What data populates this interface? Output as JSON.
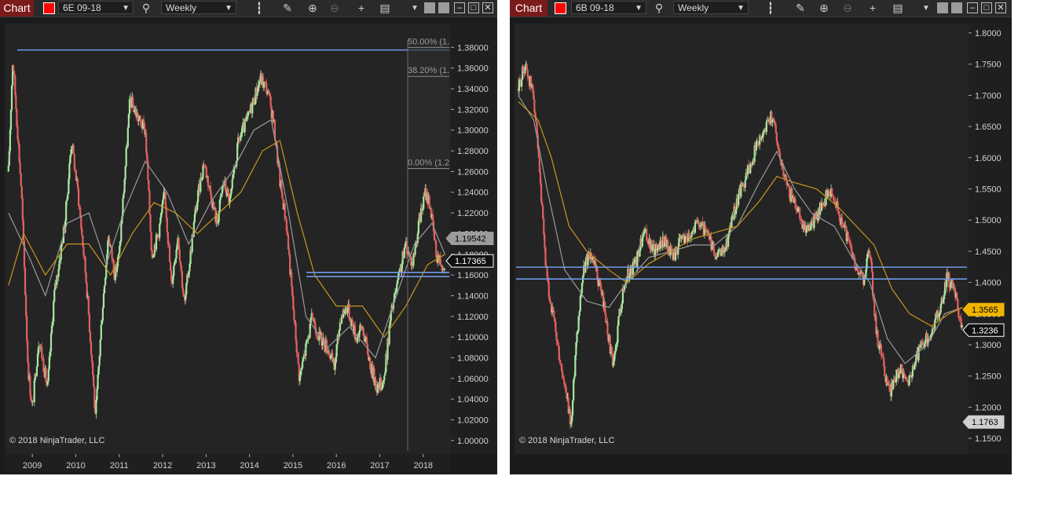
{
  "windows": [
    {
      "toolbar": {
        "chart_label": "Chart",
        "instrument": "6E 09-18",
        "interval": "Weekly",
        "icons": [
          "search-icon",
          "bar-style-icon",
          "draw-pen-icon",
          "zoom-in-icon",
          "zoom-out-icon",
          "crosshair-icon",
          "data-box-icon",
          "dropdown-arrow-icon",
          "tile-icon",
          "minimize-icon",
          "maximize-icon",
          "close-icon"
        ]
      },
      "copyright": "© 2018 NinjaTrader, LLC",
      "colors": {
        "up": "#a8e6a1",
        "down": "#e06060",
        "sma_fast": "#9a9a9a",
        "sma_slow": "#c8961e",
        "hline": "#6f9be8",
        "tag_gray": "#9c9c9c",
        "tag_white": "#ffffff"
      }
    },
    {
      "toolbar": {
        "chart_label": "Chart",
        "instrument": "6B 09-18",
        "interval": "Weekly",
        "icons": [
          "search-icon",
          "bar-style-icon",
          "draw-pen-icon",
          "zoom-in-icon",
          "zoom-out-icon",
          "crosshair-icon",
          "data-box-icon",
          "dropdown-arrow-icon",
          "tile-icon",
          "minimize-icon",
          "maximize-icon",
          "close-icon"
        ]
      },
      "copyright": "© 2018 NinjaTrader, LLC",
      "colors": {
        "up": "#a8e6a1",
        "down": "#e06060",
        "sma_fast": "#9a9a9a",
        "sma_slow": "#c8961e",
        "hline": "#6f9be8",
        "tag_gold": "#f0b400",
        "tag_white": "#ffffff",
        "tag_gray": "#cfcfcf"
      }
    }
  ],
  "chart_data": [
    {
      "type": "candlestick",
      "instrument": "6E 09-18",
      "interval": "Weekly",
      "x_ticks": [
        "2009",
        "2010",
        "2011",
        "2012",
        "2013",
        "2014",
        "2015",
        "2016",
        "2017",
        "2018"
      ],
      "x_range": [
        2008.4,
        2018.6
      ],
      "y_ticks": [
        "1.38000",
        "1.36000",
        "1.34000",
        "1.32000",
        "1.30000",
        "1.28000",
        "1.26000",
        "1.24000",
        "1.22000",
        "1.20000",
        "1.18000",
        "1.16000",
        "1.14000",
        "1.12000",
        "1.10000",
        "1.08000",
        "1.06000",
        "1.04000",
        "1.02000",
        "1.00000"
      ],
      "y_range": [
        0.99,
        1.4
      ],
      "price_path": [
        [
          2008.45,
          1.26
        ],
        [
          2008.55,
          1.37
        ],
        [
          2008.75,
          1.24
        ],
        [
          2008.9,
          1.07
        ],
        [
          2009.0,
          1.03
        ],
        [
          2009.15,
          1.1
        ],
        [
          2009.35,
          1.05
        ],
        [
          2009.5,
          1.14
        ],
        [
          2009.75,
          1.21
        ],
        [
          2009.9,
          1.29
        ],
        [
          2010.05,
          1.24
        ],
        [
          2010.25,
          1.15
        ],
        [
          2010.4,
          1.06
        ],
        [
          2010.45,
          1.02
        ],
        [
          2010.6,
          1.12
        ],
        [
          2010.75,
          1.2
        ],
        [
          2010.9,
          1.16
        ],
        [
          2011.0,
          1.18
        ],
        [
          2011.25,
          1.33
        ],
        [
          2011.45,
          1.31
        ],
        [
          2011.6,
          1.3
        ],
        [
          2011.75,
          1.18
        ],
        [
          2011.9,
          1.2
        ],
        [
          2012.05,
          1.24
        ],
        [
          2012.2,
          1.15
        ],
        [
          2012.35,
          1.2
        ],
        [
          2012.5,
          1.13
        ],
        [
          2012.75,
          1.22
        ],
        [
          2012.95,
          1.27
        ],
        [
          2013.1,
          1.24
        ],
        [
          2013.25,
          1.21
        ],
        [
          2013.4,
          1.25
        ],
        [
          2013.55,
          1.23
        ],
        [
          2013.75,
          1.29
        ],
        [
          2013.95,
          1.31
        ],
        [
          2014.1,
          1.33
        ],
        [
          2014.25,
          1.35
        ],
        [
          2014.4,
          1.34
        ],
        [
          2014.55,
          1.31
        ],
        [
          2014.7,
          1.25
        ],
        [
          2014.85,
          1.21
        ],
        [
          2015.0,
          1.13
        ],
        [
          2015.15,
          1.06
        ],
        [
          2015.3,
          1.09
        ],
        [
          2015.45,
          1.12
        ],
        [
          2015.6,
          1.1
        ],
        [
          2015.8,
          1.09
        ],
        [
          2015.95,
          1.07
        ],
        [
          2016.1,
          1.12
        ],
        [
          2016.25,
          1.13
        ],
        [
          2016.45,
          1.1
        ],
        [
          2016.6,
          1.11
        ],
        [
          2016.8,
          1.07
        ],
        [
          2016.95,
          1.05
        ],
        [
          2017.1,
          1.06
        ],
        [
          2017.25,
          1.12
        ],
        [
          2017.45,
          1.16
        ],
        [
          2017.6,
          1.19
        ],
        [
          2017.75,
          1.17
        ],
        [
          2017.9,
          1.21
        ],
        [
          2018.05,
          1.24
        ],
        [
          2018.15,
          1.23
        ],
        [
          2018.3,
          1.18
        ],
        [
          2018.45,
          1.17
        ],
        [
          2018.5,
          1.17365
        ]
      ],
      "sma_fast_path": [
        [
          2008.45,
          1.22
        ],
        [
          2008.9,
          1.18
        ],
        [
          2009.3,
          1.14
        ],
        [
          2009.8,
          1.21
        ],
        [
          2010.3,
          1.22
        ],
        [
          2010.7,
          1.17
        ],
        [
          2011.1,
          1.22
        ],
        [
          2011.6,
          1.27
        ],
        [
          2012.1,
          1.24
        ],
        [
          2012.6,
          1.19
        ],
        [
          2013.1,
          1.23
        ],
        [
          2013.6,
          1.26
        ],
        [
          2014.1,
          1.3
        ],
        [
          2014.5,
          1.31
        ],
        [
          2014.9,
          1.22
        ],
        [
          2015.3,
          1.12
        ],
        [
          2015.8,
          1.09
        ],
        [
          2016.3,
          1.11
        ],
        [
          2016.9,
          1.08
        ],
        [
          2017.3,
          1.13
        ],
        [
          2017.8,
          1.19
        ],
        [
          2018.2,
          1.21
        ],
        [
          2018.5,
          1.18
        ]
      ],
      "sma_slow_path": [
        [
          2008.45,
          1.15
        ],
        [
          2008.8,
          1.2
        ],
        [
          2009.3,
          1.16
        ],
        [
          2009.8,
          1.19
        ],
        [
          2010.3,
          1.19
        ],
        [
          2010.8,
          1.16
        ],
        [
          2011.3,
          1.2
        ],
        [
          2011.8,
          1.23
        ],
        [
          2012.3,
          1.22
        ],
        [
          2012.8,
          1.2
        ],
        [
          2013.3,
          1.22
        ],
        [
          2013.8,
          1.24
        ],
        [
          2014.3,
          1.28
        ],
        [
          2014.7,
          1.29
        ],
        [
          2015.1,
          1.22
        ],
        [
          2015.5,
          1.16
        ],
        [
          2016.0,
          1.13
        ],
        [
          2016.6,
          1.13
        ],
        [
          2017.1,
          1.1
        ],
        [
          2017.6,
          1.13
        ],
        [
          2018.1,
          1.17
        ],
        [
          2018.5,
          1.18
        ]
      ],
      "horizontal_lines": [
        1.3775,
        1.1625,
        1.1585
      ],
      "fibonacci": [
        {
          "label": "50.00% (1.",
          "value": 1.38
        },
        {
          "label": "38.20% (1.",
          "value": 1.352
        },
        {
          "label": "0.00% (1.2",
          "value": 1.263
        }
      ],
      "price_markers": [
        {
          "value": 1.19542,
          "label": "1.19542",
          "style": "gray"
        },
        {
          "value": 1.17365,
          "label": "1.17365",
          "style": "white"
        }
      ]
    },
    {
      "type": "candlestick",
      "instrument": "6B 09-18",
      "interval": "Weekly",
      "x_range": [
        2008.4,
        2018.6
      ],
      "y_ticks": [
        "1.8000",
        "1.7500",
        "1.7000",
        "1.6500",
        "1.6000",
        "1.5500",
        "1.5000",
        "1.4500",
        "1.4000",
        "1.3500",
        "1.3000",
        "1.2500",
        "1.2000",
        "1.1500"
      ],
      "y_range": [
        1.13,
        1.81
      ],
      "price_path": [
        [
          2008.45,
          1.71
        ],
        [
          2008.6,
          1.75
        ],
        [
          2008.8,
          1.7
        ],
        [
          2008.95,
          1.55
        ],
        [
          2009.1,
          1.4
        ],
        [
          2009.25,
          1.34
        ],
        [
          2009.4,
          1.27
        ],
        [
          2009.55,
          1.21
        ],
        [
          2009.65,
          1.17
        ],
        [
          2009.75,
          1.3
        ],
        [
          2009.9,
          1.41
        ],
        [
          2010.05,
          1.45
        ],
        [
          2010.2,
          1.42
        ],
        [
          2010.35,
          1.38
        ],
        [
          2010.5,
          1.31
        ],
        [
          2010.6,
          1.26
        ],
        [
          2010.75,
          1.36
        ],
        [
          2010.9,
          1.41
        ],
        [
          2011.1,
          1.43
        ],
        [
          2011.3,
          1.48
        ],
        [
          2011.5,
          1.45
        ],
        [
          2011.75,
          1.47
        ],
        [
          2011.95,
          1.44
        ],
        [
          2012.15,
          1.47
        ],
        [
          2012.35,
          1.48
        ],
        [
          2012.55,
          1.5
        ],
        [
          2012.75,
          1.47
        ],
        [
          2012.95,
          1.44
        ],
        [
          2013.15,
          1.46
        ],
        [
          2013.35,
          1.52
        ],
        [
          2013.6,
          1.57
        ],
        [
          2013.85,
          1.62
        ],
        [
          2014.05,
          1.65
        ],
        [
          2014.2,
          1.67
        ],
        [
          2014.35,
          1.61
        ],
        [
          2014.55,
          1.55
        ],
        [
          2014.75,
          1.52
        ],
        [
          2014.95,
          1.48
        ],
        [
          2015.15,
          1.5
        ],
        [
          2015.35,
          1.53
        ],
        [
          2015.55,
          1.55
        ],
        [
          2015.75,
          1.5
        ],
        [
          2015.95,
          1.46
        ],
        [
          2016.1,
          1.42
        ],
        [
          2016.25,
          1.4
        ],
        [
          2016.4,
          1.45
        ],
        [
          2016.55,
          1.32
        ],
        [
          2016.7,
          1.27
        ],
        [
          2016.85,
          1.22
        ],
        [
          2016.95,
          1.25
        ],
        [
          2017.1,
          1.26
        ],
        [
          2017.25,
          1.24
        ],
        [
          2017.4,
          1.26
        ],
        [
          2017.55,
          1.3
        ],
        [
          2017.7,
          1.31
        ],
        [
          2017.85,
          1.33
        ],
        [
          2018.0,
          1.36
        ],
        [
          2018.15,
          1.41
        ],
        [
          2018.3,
          1.39
        ],
        [
          2018.45,
          1.34
        ],
        [
          2018.5,
          1.3236
        ]
      ],
      "sma_fast_path": [
        [
          2008.45,
          1.7
        ],
        [
          2008.8,
          1.66
        ],
        [
          2009.1,
          1.55
        ],
        [
          2009.5,
          1.42
        ],
        [
          2010.0,
          1.37
        ],
        [
          2010.5,
          1.36
        ],
        [
          2010.9,
          1.4
        ],
        [
          2011.4,
          1.44
        ],
        [
          2011.9,
          1.45
        ],
        [
          2012.4,
          1.46
        ],
        [
          2012.9,
          1.46
        ],
        [
          2013.4,
          1.49
        ],
        [
          2013.9,
          1.56
        ],
        [
          2014.3,
          1.61
        ],
        [
          2014.7,
          1.55
        ],
        [
          2015.1,
          1.51
        ],
        [
          2015.6,
          1.49
        ],
        [
          2016.0,
          1.44
        ],
        [
          2016.4,
          1.4
        ],
        [
          2016.8,
          1.31
        ],
        [
          2017.2,
          1.27
        ],
        [
          2017.7,
          1.3
        ],
        [
          2018.1,
          1.35
        ],
        [
          2018.5,
          1.36
        ]
      ],
      "sma_slow_path": [
        [
          2008.45,
          1.69
        ],
        [
          2008.9,
          1.66
        ],
        [
          2009.2,
          1.6
        ],
        [
          2009.6,
          1.49
        ],
        [
          2010.0,
          1.45
        ],
        [
          2010.5,
          1.42
        ],
        [
          2010.9,
          1.4
        ],
        [
          2011.4,
          1.43
        ],
        [
          2011.9,
          1.45
        ],
        [
          2012.4,
          1.47
        ],
        [
          2012.9,
          1.48
        ],
        [
          2013.4,
          1.49
        ],
        [
          2013.9,
          1.53
        ],
        [
          2014.3,
          1.57
        ],
        [
          2014.7,
          1.56
        ],
        [
          2015.2,
          1.55
        ],
        [
          2015.7,
          1.52
        ],
        [
          2016.1,
          1.49
        ],
        [
          2016.5,
          1.46
        ],
        [
          2016.9,
          1.39
        ],
        [
          2017.3,
          1.35
        ],
        [
          2017.8,
          1.33
        ],
        [
          2018.2,
          1.35
        ],
        [
          2018.5,
          1.36
        ]
      ],
      "horizontal_lines": [
        1.4245,
        1.4055
      ],
      "price_markers": [
        {
          "value": 1.3565,
          "label": "1.3565",
          "style": "gold"
        },
        {
          "value": 1.3236,
          "label": "1.3236",
          "style": "white"
        },
        {
          "value": 1.1763,
          "label": "1.1763",
          "style": "gray"
        }
      ]
    }
  ]
}
